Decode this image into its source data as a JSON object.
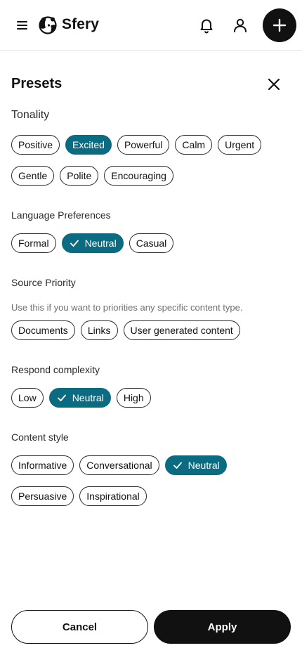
{
  "app": {
    "brand": "Sfery"
  },
  "icons": {
    "menu": "hamburger-icon",
    "logo": "panda-logo",
    "bell": "bell-icon",
    "user": "user-icon",
    "add": "plus-icon",
    "close": "close-icon",
    "check": "check-icon"
  },
  "colors": {
    "accent": "#0b6b80",
    "primary": "#111111",
    "border": "#e6e6e6",
    "muted": "#707070"
  },
  "panel": {
    "title": "Presets"
  },
  "tonality": {
    "label": "Tonality",
    "row1": [
      "Positive",
      "Excited",
      "Powerful",
      "Calm",
      "Urgent"
    ],
    "row2": [
      "Gentle",
      "Polite",
      "Encouraging"
    ],
    "selected": "Excited"
  },
  "language": {
    "label": "Language Preferences",
    "options": [
      "Formal",
      "Neutral",
      "Casual"
    ],
    "selected": "Neutral"
  },
  "source": {
    "label": "Source Priority",
    "hint": "Use this if you want to priorities any specific content type.",
    "options": [
      "Documents",
      "Links",
      "User generated content"
    ]
  },
  "complexity": {
    "label": "Respond complexity",
    "options": [
      "Low",
      "Neutral",
      "High"
    ],
    "selected": "Neutral"
  },
  "content_style": {
    "label": "Content style",
    "row1": [
      "Informative",
      "Conversational",
      "Neutral"
    ],
    "row2": [
      "Persuasive",
      "Inspirational"
    ],
    "selected": "Neutral"
  },
  "footer": {
    "cancel": "Cancel",
    "apply": "Apply"
  }
}
